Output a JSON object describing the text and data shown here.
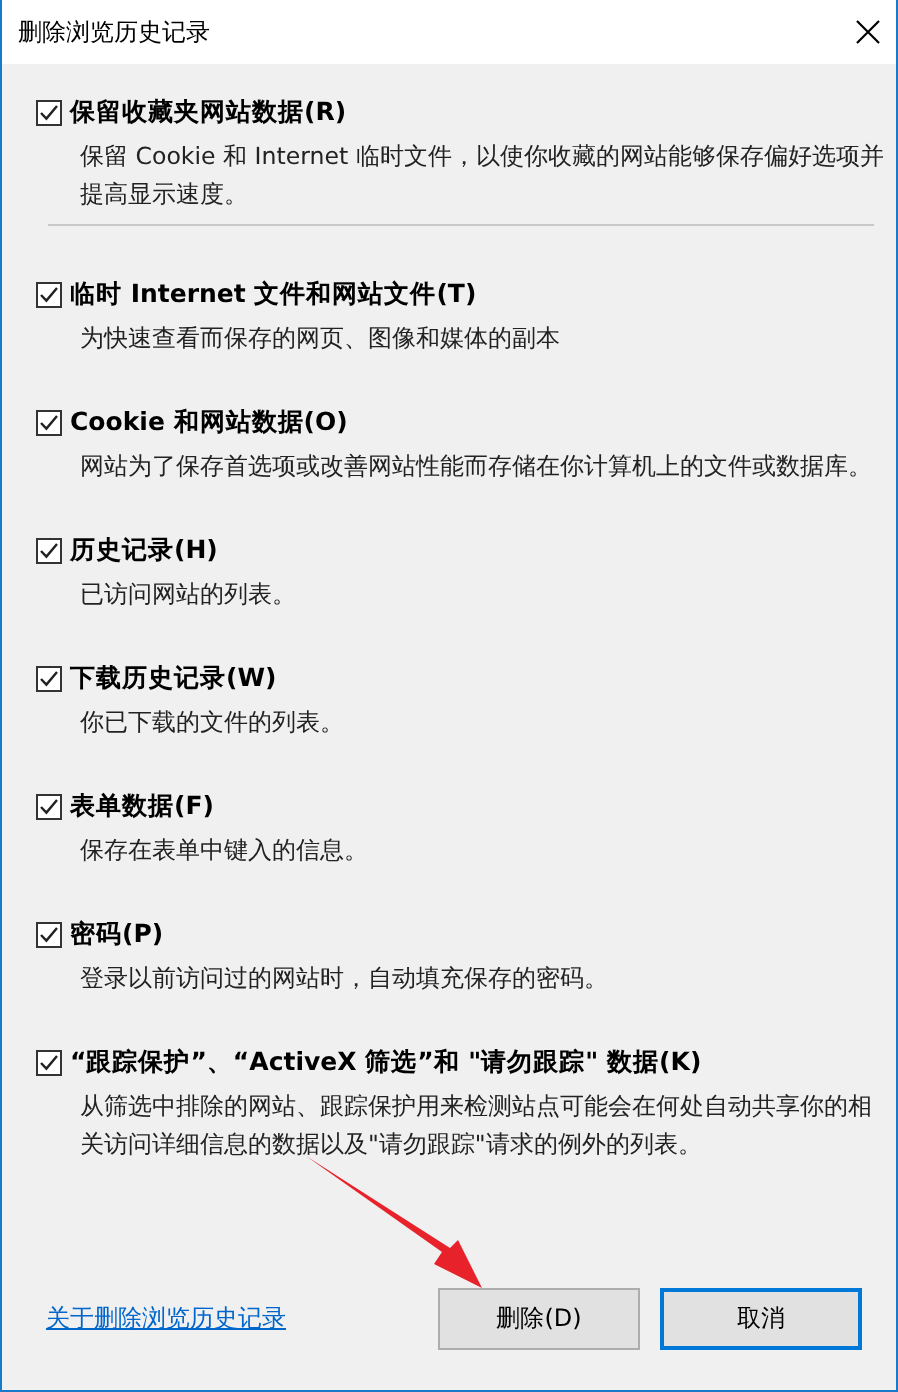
{
  "window": {
    "title": "删除浏览历史记录"
  },
  "options": [
    {
      "label": "保留收藏夹网站数据(R)",
      "description": "保留 Cookie 和 Internet 临时文件，以使你收藏的网站能够保存偏好选项并提高显示速度。",
      "checked": true
    },
    {
      "label": "临时 Internet 文件和网站文件(T)",
      "description": "为快速查看而保存的网页、图像和媒体的副本",
      "checked": true
    },
    {
      "label": "Cookie 和网站数据(O)",
      "description": "网站为了保存首选项或改善网站性能而存储在你计算机上的文件或数据库。",
      "checked": true
    },
    {
      "label": "历史记录(H)",
      "description": "已访问网站的列表。",
      "checked": true
    },
    {
      "label": "下载历史记录(W)",
      "description": "你已下载的文件的列表。",
      "checked": true
    },
    {
      "label": "表单数据(F)",
      "description": "保存在表单中键入的信息。",
      "checked": true
    },
    {
      "label": "密码(P)",
      "description": "登录以前访问过的网站时，自动填充保存的密码。",
      "checked": true
    },
    {
      "label": "“跟踪保护”、“ActiveX 筛选”和 \"请勿跟踪\" 数据(K)",
      "description": "从筛选中排除的网站、跟踪保护用来检测站点可能会在何处自动共享你的相关访问详细信息的数据以及\"请勿跟踪\"请求的例外的列表。",
      "checked": true
    }
  ],
  "link": "关于删除浏览历史记录",
  "buttons": [
    {
      "label": "删除(D)",
      "default": false
    },
    {
      "label": "取消",
      "default": true
    }
  ]
}
